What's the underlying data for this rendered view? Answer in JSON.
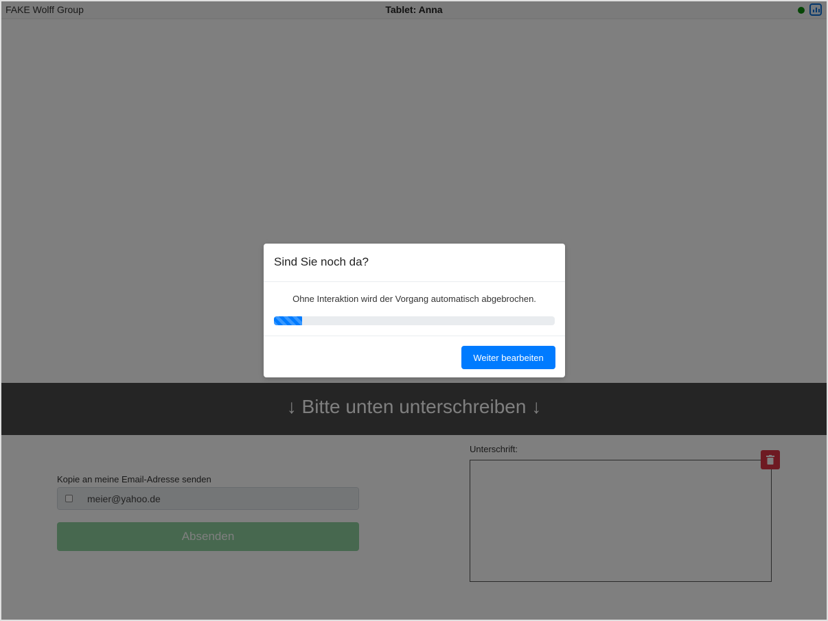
{
  "header": {
    "company": "FAKE Wolff Group",
    "tablet_title": "Tablet: Anna",
    "status_color": "#0a8a0a",
    "stats_icon": "bar-chart-icon"
  },
  "banner": {
    "text": "↓ Bitte unten unterschreiben ↓"
  },
  "form": {
    "copy_label": "Kopie an meine Email-Adresse senden",
    "copy_checked": false,
    "email_value": "meier@yahoo.de",
    "send_label": "Absenden",
    "signature_label": "Unterschrift:",
    "clear_icon": "trash-icon"
  },
  "modal": {
    "title": "Sind Sie noch da?",
    "message": "Ohne Interaktion wird der Vorgang automatisch abgebrochen.",
    "progress_fraction": 0.1,
    "continue_label": "Weiter bearbeiten"
  },
  "colors": {
    "primary": "#007bff",
    "success_disabled": "#8fd19e",
    "danger": "#dc3545",
    "banner_bg": "#4a4a4a"
  }
}
